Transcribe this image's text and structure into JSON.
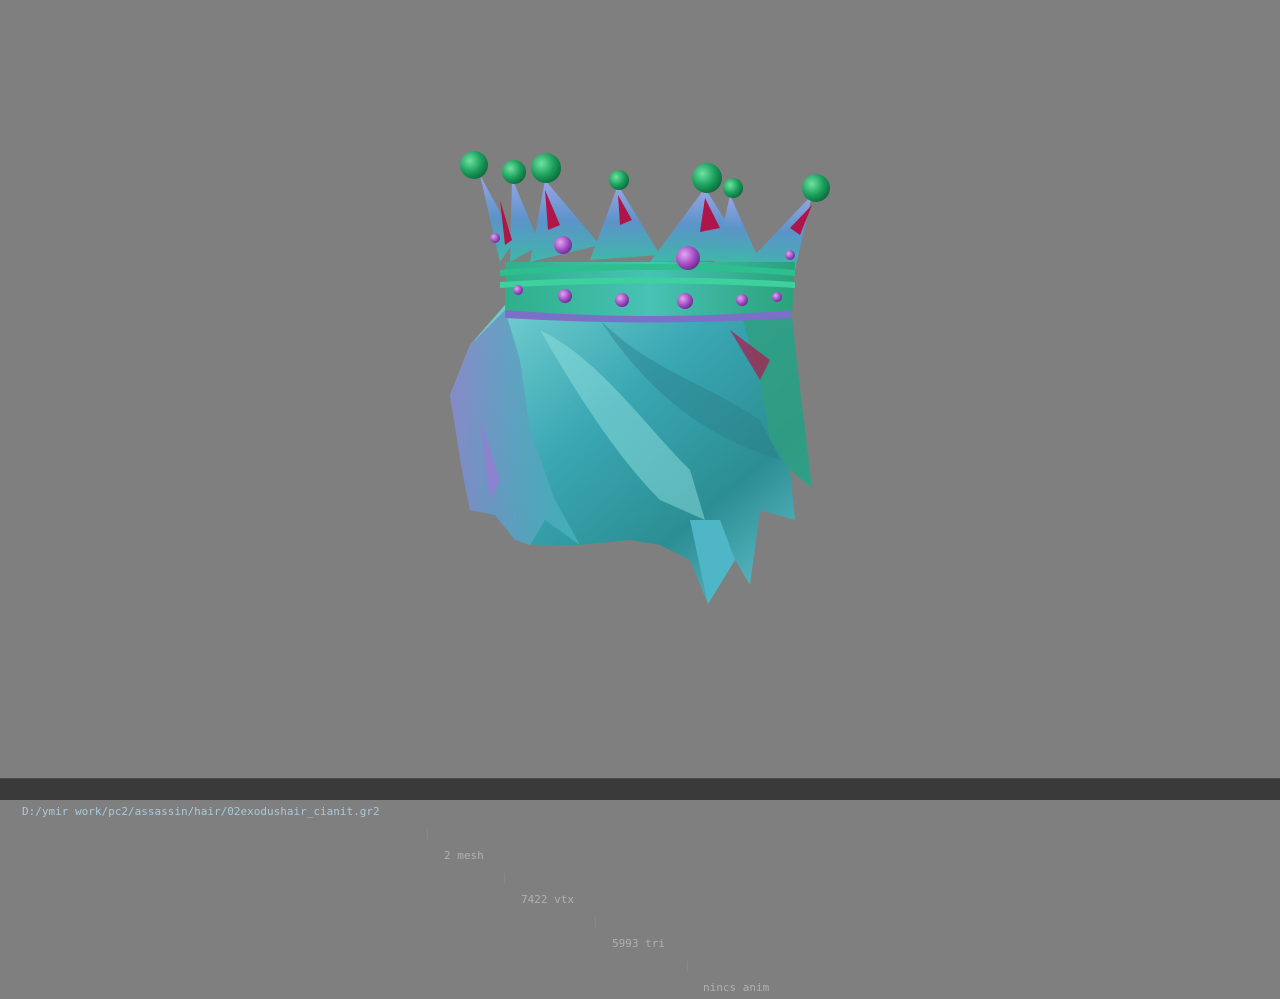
{
  "viewer": {
    "background_color": "#7f7f7f",
    "model_subject": "crown-hair-model"
  },
  "statusbar": {
    "file_path": "D:/ymir work/pc2/assassin/hair/02exodushair_cianit.gr2",
    "separator": "|",
    "mesh": "2 mesh",
    "vertices": "7422 vtx",
    "triangles": "5993 tri",
    "animation": "nincs anim"
  },
  "colors": {
    "status_bg": "#3a3a3a",
    "hair_teal": "#3fb3b8",
    "crown_green": "#1fa566",
    "gem_purple": "#a855c7",
    "accent_crimson": "#b0154a"
  }
}
